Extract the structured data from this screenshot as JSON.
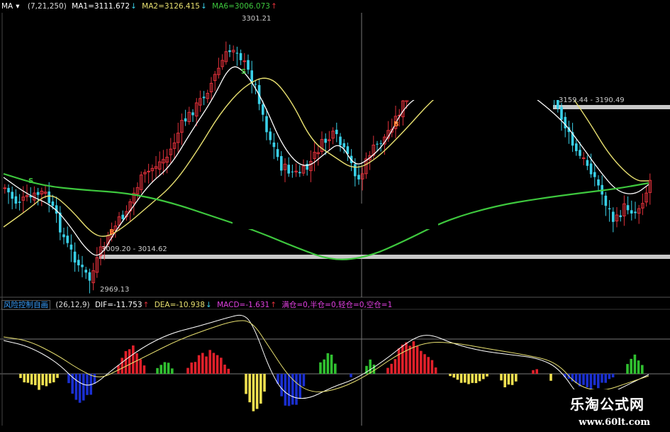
{
  "main_header": {
    "indicator_label": "MA",
    "params": "(7,21,250)",
    "ma1": "MA1=3111.672",
    "ma1_arrow": "↓",
    "ma2": "MA2=3126.415",
    "ma2_arrow": "↓",
    "ma6": "MA6=3006.073",
    "ma6_arrow": "↑"
  },
  "macd_header": {
    "indicator_label": "风险控制自画",
    "params": "(26,12,9)",
    "dif": "DIF=-11.753",
    "dif_arrow": "↑",
    "dea": "DEA=-10.938",
    "dea_arrow": "↓",
    "macd": "MACD=-1.631",
    "macd_arrow": "↑",
    "position_text": "满仓=0,半仓=0,轻仓=0,空仓=1"
  },
  "annotations": {
    "high": "3301.21",
    "low": "2969.13",
    "range_low": "3009.20 - 3014.62",
    "range_high": "3159.44 - 3190.49"
  },
  "signals": {
    "sell": "S",
    "buy": "B"
  },
  "watermark": {
    "site_name": "乐淘公式网",
    "url": "www.60lt.com"
  },
  "colors": {
    "up": "#e0303a",
    "down": "#39d0e8",
    "ma1": "#ffffff",
    "ma2": "#e8e070",
    "ma6": "#3ec83e",
    "hist_red": "#e0202a",
    "hist_green": "#30c030",
    "hist_yellow": "#f0e050",
    "hist_blue": "#1a2fd0",
    "range": "#c8c8c8"
  }
}
